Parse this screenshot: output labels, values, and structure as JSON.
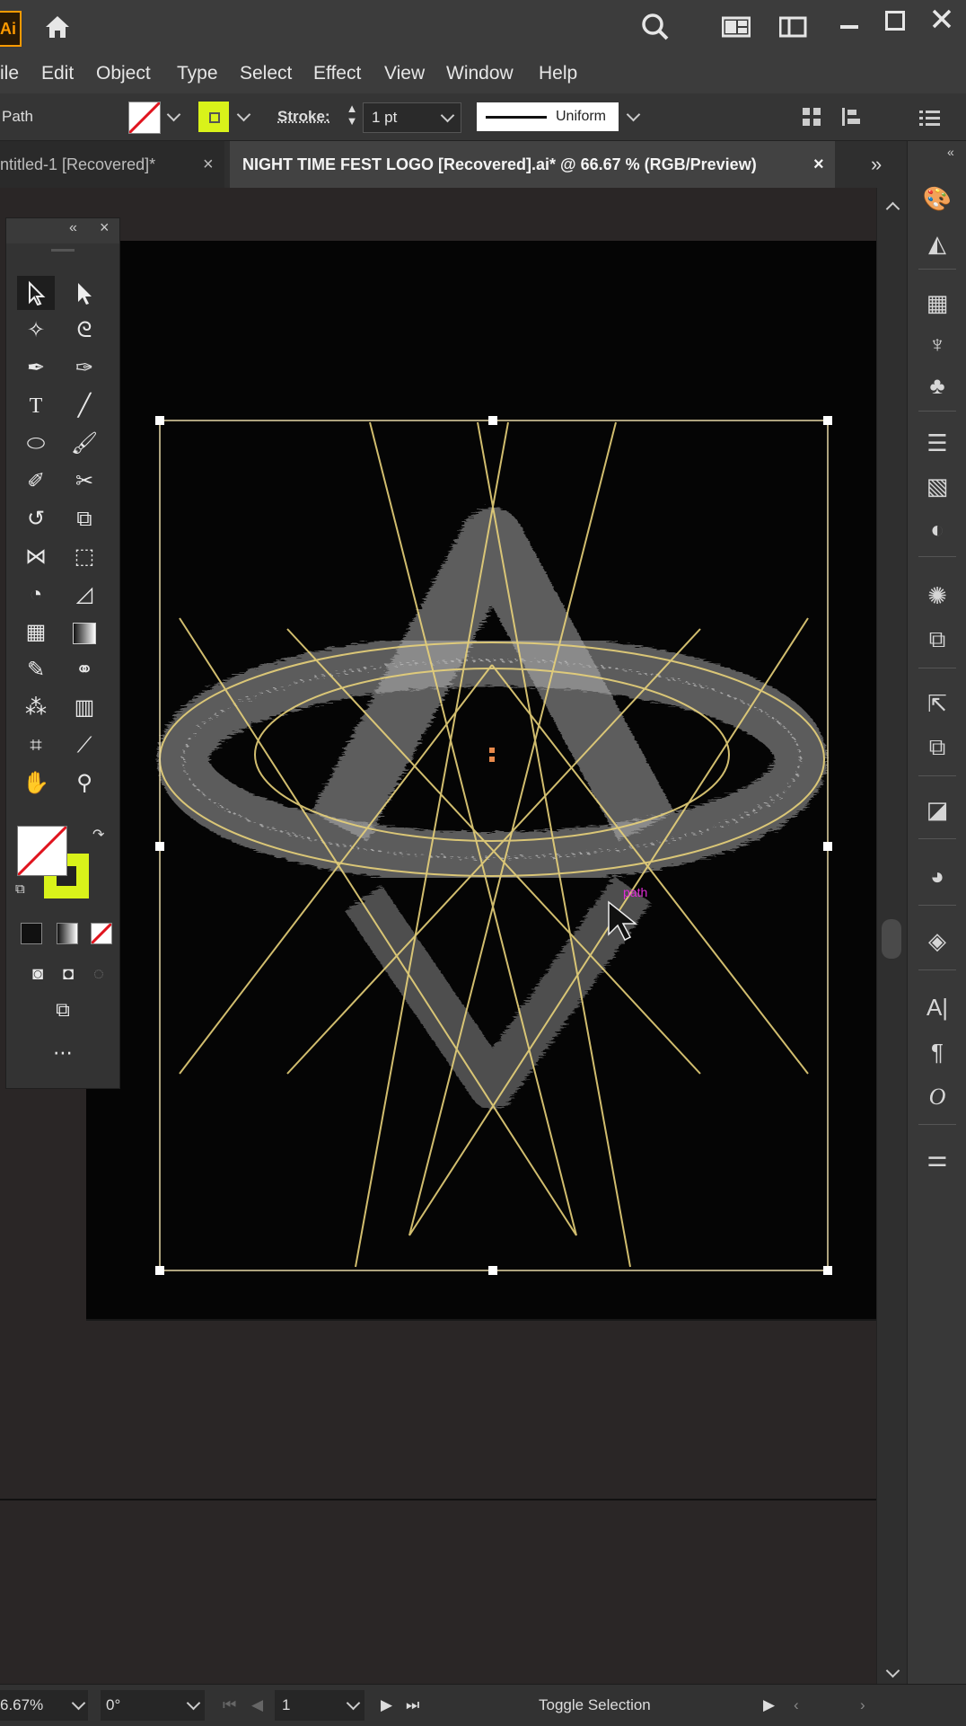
{
  "app": {
    "logo": "Ai"
  },
  "titlebar": {
    "icons": [
      "home-icon",
      "search-icon",
      "arrange-documents-icon",
      "workspace-icon",
      "minimize-icon",
      "maximize-icon",
      "close-icon"
    ]
  },
  "menu": {
    "items": [
      "ile",
      "Edit",
      "Object",
      "Type",
      "Select",
      "Effect",
      "View",
      "Window",
      "Help"
    ]
  },
  "controlbar": {
    "selection_label": "Path",
    "stroke_label": "Stroke:",
    "stroke_weight": "1 pt",
    "stroke_profile": "Uniform"
  },
  "tabs": [
    {
      "label": "ntitled-1 [Recovered]*",
      "active": false
    },
    {
      "label": "NIGHT TIME FEST LOGO [Recovered].ai* @ 66.67 % (RGB/Preview)",
      "active": true
    }
  ],
  "canvas": {
    "hover_label": "path"
  },
  "statusbar": {
    "zoom": "6.67%",
    "rotation": "0°",
    "artboard_number": "1",
    "info": "Toggle Selection"
  },
  "colors": {
    "accent_fill": "#d9f21a",
    "guide": "#e8d27a",
    "artboard": "#050505",
    "hover_label": "#e02bd6"
  }
}
